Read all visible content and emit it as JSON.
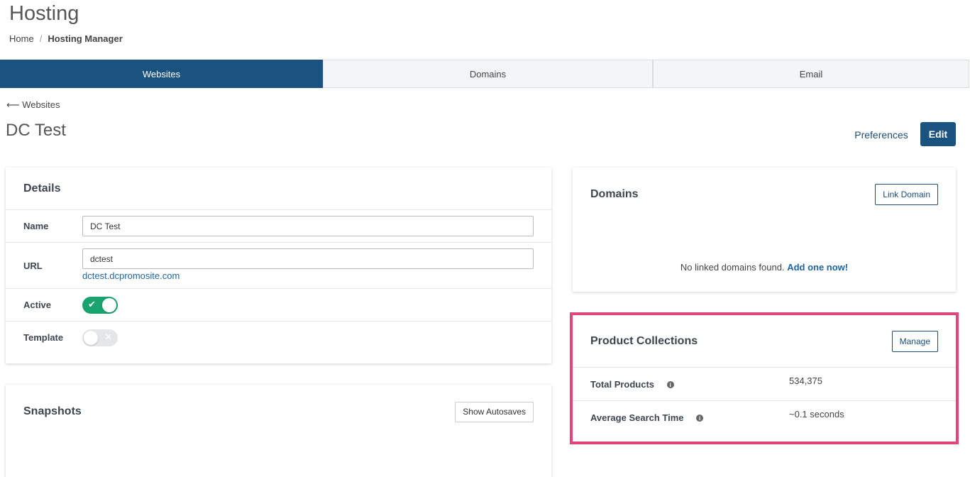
{
  "header": {
    "title": "Hosting",
    "breadcrumb": {
      "home": "Home",
      "separator": "/",
      "current": "Hosting Manager"
    }
  },
  "tabs": [
    {
      "label": "Websites",
      "active": true
    },
    {
      "label": "Domains",
      "active": false
    },
    {
      "label": "Email",
      "active": false
    }
  ],
  "back_link": {
    "arrow": "⟵",
    "label": "Websites"
  },
  "site": {
    "title": "DC Test"
  },
  "actions": {
    "preferences": "Preferences",
    "edit": "Edit"
  },
  "details": {
    "title": "Details",
    "name_label": "Name",
    "name_value": "DC Test",
    "url_label": "URL",
    "url_value": "dctest",
    "url_link": "dctest.dcpromosite.com",
    "active_label": "Active",
    "active_on": true,
    "template_label": "Template",
    "template_on": false
  },
  "snapshots": {
    "title": "Snapshots",
    "show_autosaves": "Show Autosaves"
  },
  "domains": {
    "title": "Domains",
    "link_button": "Link Domain",
    "empty_text": "No linked domains found.",
    "add_link": "Add one now!"
  },
  "product_collections": {
    "title": "Product Collections",
    "manage_button": "Manage",
    "total_products_label": "Total Products",
    "total_products_value": "534,375",
    "avg_search_label": "Average Search Time",
    "avg_search_value": "~0.1 seconds"
  },
  "colors": {
    "primary": "#1b5380",
    "toggle_on": "#1aa36e",
    "highlight": "#e0457b"
  }
}
